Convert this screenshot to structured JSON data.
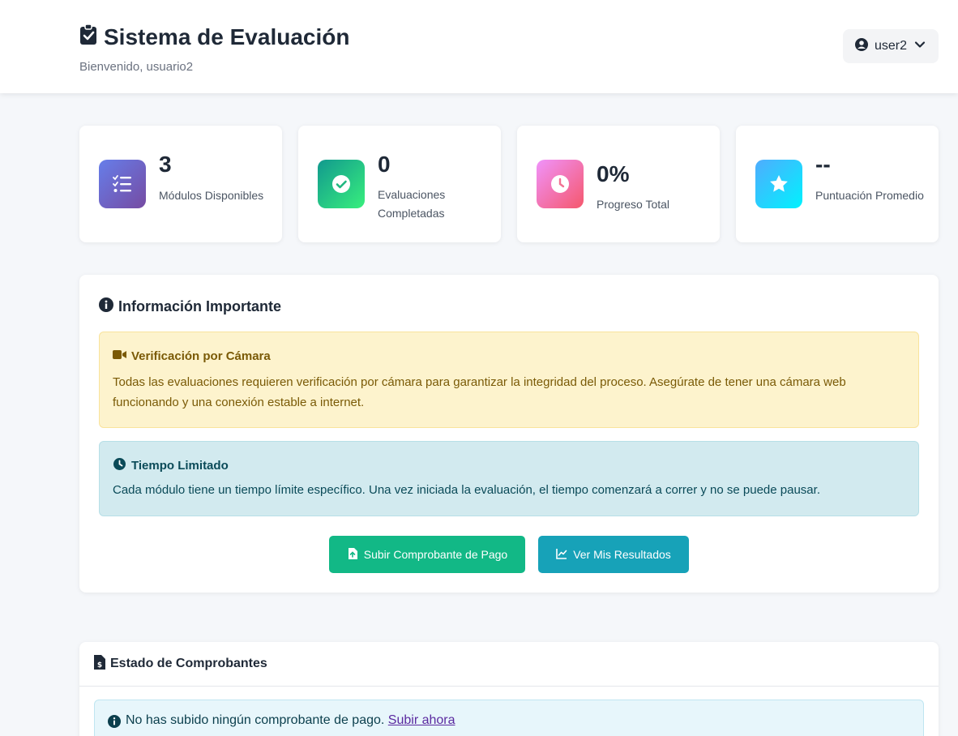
{
  "header": {
    "title": "Sistema de Evaluación",
    "welcome": "Bienvenido, usuario2",
    "user_label": "user2"
  },
  "stats": [
    {
      "value": "3",
      "label": "Módulos Disponibles",
      "icon": "tasks-icon",
      "gradient": [
        "#667eea",
        "#764ba2"
      ]
    },
    {
      "value": "0",
      "label": "Evaluaciones Completadas",
      "icon": "check-circle-icon",
      "gradient": [
        "#11998e",
        "#38ef7d"
      ]
    },
    {
      "value": "0%",
      "label": "Progreso Total",
      "icon": "clock-icon",
      "gradient": [
        "#f093fb",
        "#f5576c"
      ]
    },
    {
      "value": "--",
      "label": "Puntuación Promedio",
      "icon": "star-icon",
      "gradient": [
        "#4facfe",
        "#00f2fe"
      ]
    }
  ],
  "info": {
    "title": "Información Importante",
    "camera": {
      "heading": "Verificación por Cámara",
      "text": "Todas las evaluaciones requieren verificación por cámara para garantizar la integridad del proceso. Asegúrate de tener una cámara web funcionando y una conexión estable a internet."
    },
    "time": {
      "heading": "Tiempo Limitado",
      "text": "Cada módulo tiene un tiempo límite específico. Una vez iniciada la evaluación, el tiempo comenzará a correr y no se puede pausar."
    },
    "upload_button": "Subir Comprobante de Pago",
    "results_button": "Ver Mis Resultados"
  },
  "receipts": {
    "title": "Estado de Comprobantes",
    "message": "No has subido ningún comprobante de pago.",
    "link": "Subir ahora"
  },
  "colors": {
    "accent_green": "#12b886",
    "accent_teal": "#17a2b8",
    "warning_bg": "#fdf3cd",
    "info_bg": "#d2eaef"
  }
}
